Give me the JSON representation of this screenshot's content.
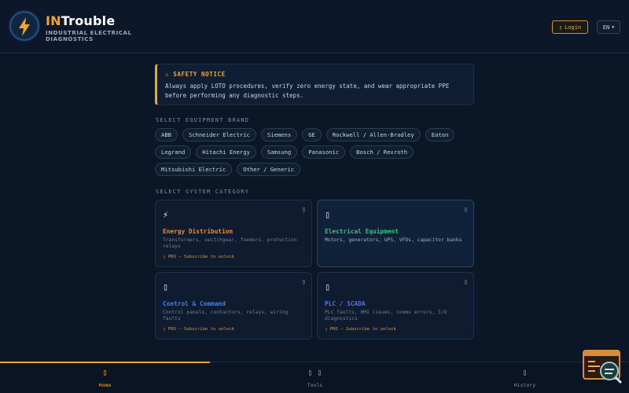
{
  "header": {
    "brand_strong": "IN",
    "brand_rest": "Trouble",
    "subtitle": "INDUSTRIAL ELECTRICAL DIAGNOSTICS",
    "login_label": "Login",
    "login_icon": "user-icon",
    "language": "EN",
    "language_icon": "chevron-down-icon"
  },
  "notice": {
    "title": "⚠ SAFETY NOTICE",
    "text": "Always apply LOTO procedures, verify zero energy state, and wear appropriate PPE before performing any diagnostic steps."
  },
  "brands": {
    "label": "SELECT EQUIPMENT BRAND",
    "items": [
      "ABB",
      "Schneider Electric",
      "Siemens",
      "GE",
      "Rockwell / Allen-Bradley",
      "Eaton",
      "Legrand",
      "Hitachi Energy",
      "Samsung",
      "Panasonic",
      "Bosch / Rexroth",
      "Mitsubishi Electric",
      "Other / Generic"
    ]
  },
  "categories": {
    "label": "SELECT SYSTEM CATEGORY",
    "items": [
      {
        "icon": "lightning-icon",
        "icon_glyph": "⚡",
        "title": "Energy Distribution",
        "title_color": "#e8902a",
        "desc": "Transformers, switchgear, feeders, protection relays",
        "pro": "▯ PRO — Subscribe to unlock",
        "locked": true
      },
      {
        "icon": "equipment-icon",
        "icon_glyph": "▯",
        "title": "Electrical Equipment",
        "title_color": "#2ec27e",
        "desc": "Motors, generators, UPS, VFDs, capacitor banks",
        "pro": "",
        "locked": false
      },
      {
        "icon": "control-icon",
        "icon_glyph": "▯",
        "title": "Control & Command",
        "title_color": "#3b82f6",
        "desc": "Control panels, contactors, relays, wiring faults",
        "pro": "▯ PRO — Subscribe to unlock",
        "locked": true
      },
      {
        "icon": "plc-icon",
        "icon_glyph": "▯",
        "title": "PLC / SCADA",
        "title_color": "#5b6ee6",
        "desc": "PLC faults, HMI issues, comms errors, I/O diagnostics",
        "pro": "▯ PRO — Subscribe to unlock",
        "locked": true
      }
    ]
  },
  "nav": {
    "items": [
      {
        "icon": "home-icon",
        "glyph": "▯",
        "label": "Home",
        "active": true
      },
      {
        "icon": "tools-icon",
        "glyph": "▯ ▯",
        "label": "Tools",
        "active": false
      },
      {
        "icon": "history-icon",
        "glyph": "▯",
        "label": "History",
        "active": false
      }
    ]
  },
  "colors": {
    "accent": "#f5a524",
    "background": "#0b1626"
  }
}
